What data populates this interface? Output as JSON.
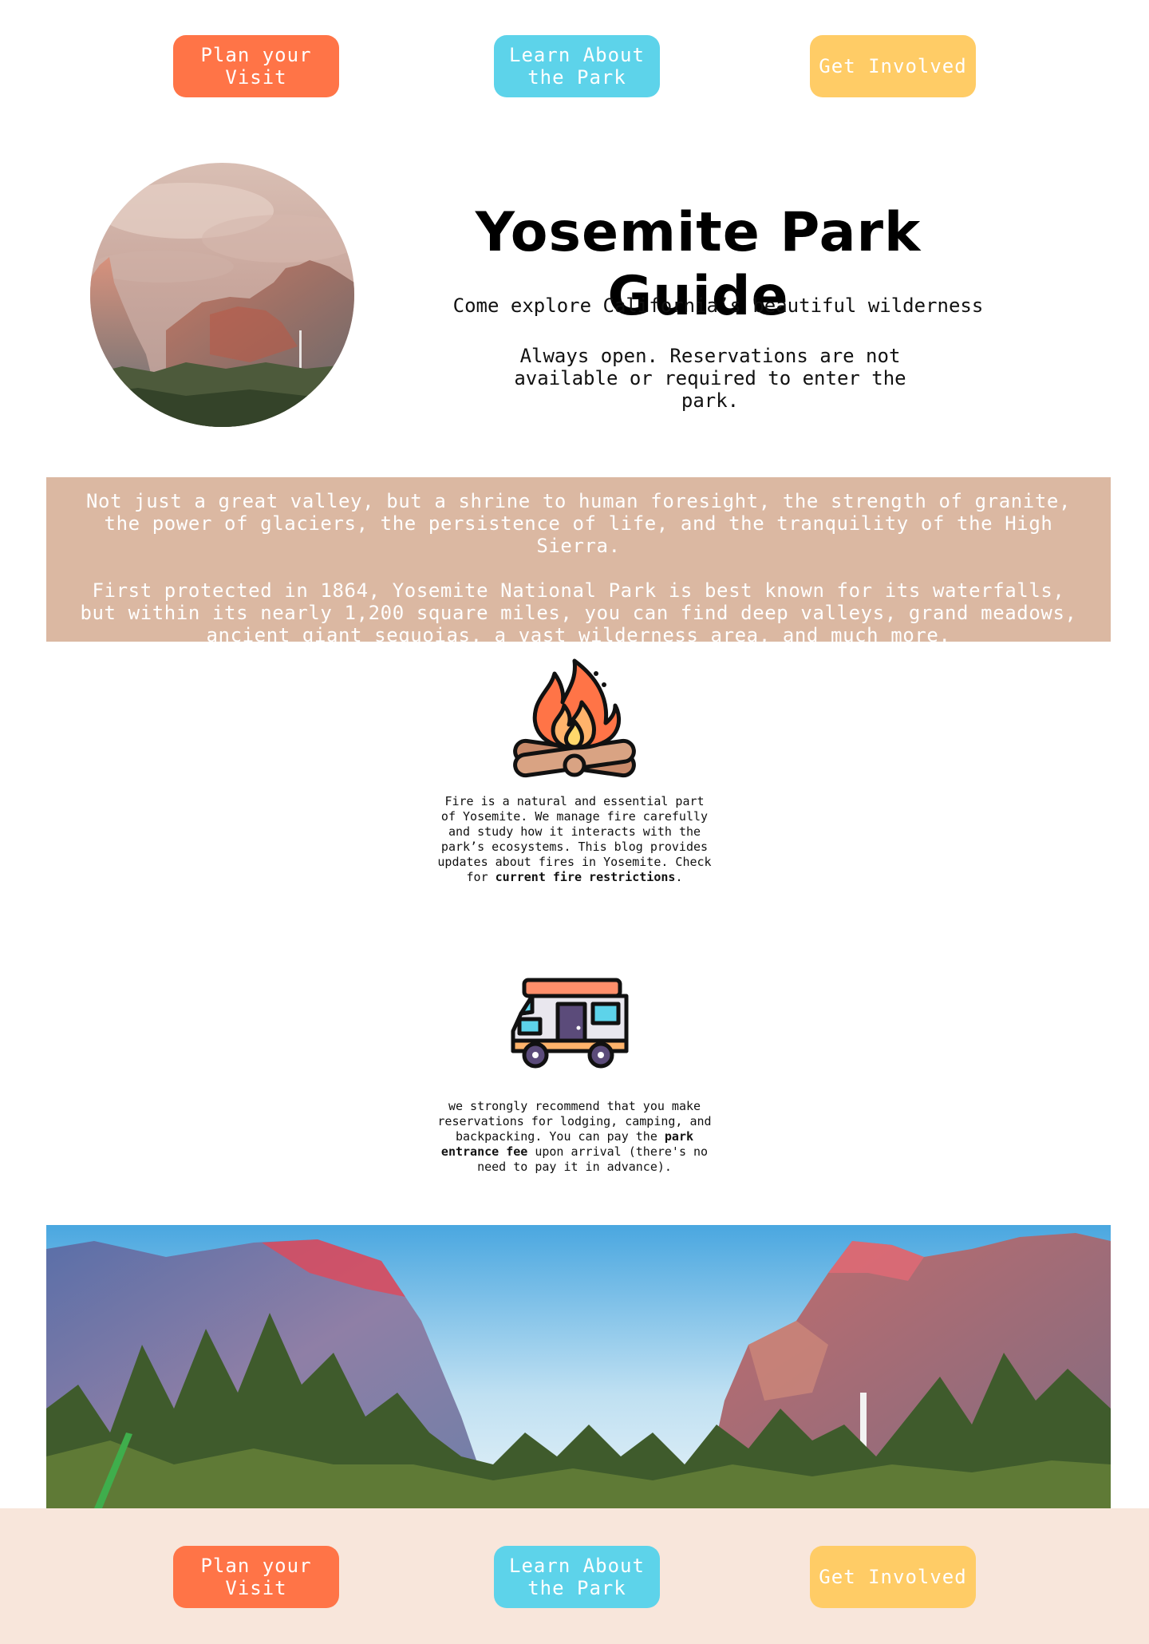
{
  "nav": {
    "plan_label": "Plan your Visit",
    "learn_label": "Learn About the Park",
    "involved_label": "Get Involved"
  },
  "hero": {
    "title": "Yosemite Park Guide",
    "subtitle": "Come explore California’s beautiful wilderness",
    "note": "Always open. Reservations are not available or required to enter the park."
  },
  "intro": {
    "paragraph1": "Not just a great valley, but a shrine to human foresight, the strength of granite, the power of glaciers, the persistence of life, and the tranquility of the High Sierra.",
    "paragraph2": "First protected in 1864, Yosemite National Park is best known for its waterfalls, but within its nearly 1,200 square miles, you can find deep valleys, grand meadows, ancient giant sequoias, a vast wilderness area, and much more."
  },
  "fire": {
    "icon": "campfire-icon",
    "text_before": "Fire is a natural and essential part of Yosemite. We manage fire carefully and study how it interacts with the park’s ecosystems. This blog provides updates about fires in Yosemite. Check for ",
    "link": "current fire restrictions",
    "text_after": "."
  },
  "reservations": {
    "icon": "rv-camper-icon",
    "text_before": "we strongly recommend that you make reservations for lodging, camping, and backpacking. You can pay the ",
    "link": "park entrance fee",
    "text_after": " upon arrival (there's no need to pay it in advance)."
  },
  "colors": {
    "plan": "#ff7447",
    "learn": "#5dd3ea",
    "involved": "#ffcc66",
    "intro_bg": "#dbb8a2",
    "footer_bg": "#f8e6db"
  }
}
